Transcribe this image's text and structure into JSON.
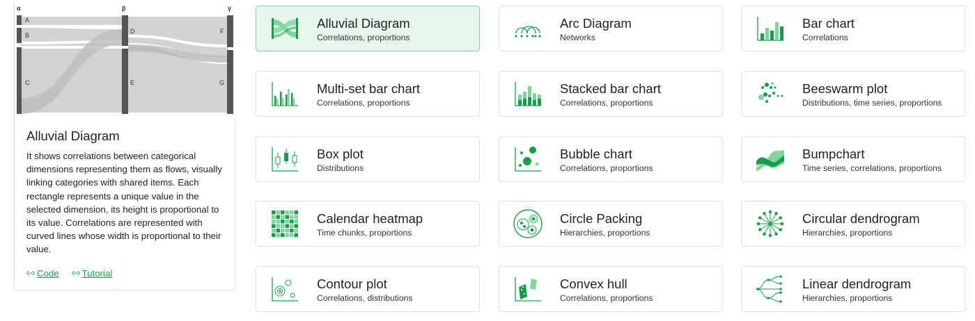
{
  "preview": {
    "dimensions": [
      "α",
      "β",
      "γ"
    ],
    "categories": [
      "A",
      "B",
      "C",
      "D",
      "E",
      "F",
      "G"
    ]
  },
  "detail": {
    "title": "Alluvial Diagram",
    "description": "It shows correlations between categorical dimensions representing them as flows, visually linking categories with shared items. Each rectangle represents a unique value in the selected dimension, its height is proportional to its value. Correlations are represented with curved lines whose width is proportional to their value.",
    "links": [
      {
        "label": "Code",
        "icon": "link-icon"
      },
      {
        "label": "Tutorial",
        "icon": "link-icon"
      }
    ]
  },
  "charts": [
    {
      "name": "Alluvial Diagram",
      "subtitle": "Correlations, proportions",
      "icon": "alluvial-icon",
      "selected": true
    },
    {
      "name": "Arc Diagram",
      "subtitle": "Networks",
      "icon": "arc-icon"
    },
    {
      "name": "Bar chart",
      "subtitle": "Correlations",
      "icon": "bar-icon"
    },
    {
      "name": "Multi-set bar chart",
      "subtitle": "Correlations, proportions",
      "icon": "multiset-bar-icon"
    },
    {
      "name": "Stacked bar chart",
      "subtitle": "Correlations, proportions",
      "icon": "stacked-bar-icon"
    },
    {
      "name": "Beeswarm plot",
      "subtitle": "Distributions, time series, proportions",
      "icon": "beeswarm-icon"
    },
    {
      "name": "Box plot",
      "subtitle": "Distributions",
      "icon": "boxplot-icon"
    },
    {
      "name": "Bubble chart",
      "subtitle": "Correlations, proportions",
      "icon": "bubble-icon"
    },
    {
      "name": "Bumpchart",
      "subtitle": "Time series, correlations, proportions",
      "icon": "bumpchart-icon"
    },
    {
      "name": "Calendar heatmap",
      "subtitle": "Time chunks, proportions",
      "icon": "calendar-heatmap-icon"
    },
    {
      "name": "Circle Packing",
      "subtitle": "Hierarchies, proportions",
      "icon": "circle-packing-icon"
    },
    {
      "name": "Circular dendrogram",
      "subtitle": "Hierarchies, proportions",
      "icon": "circular-dendrogram-icon"
    },
    {
      "name": "Contour plot",
      "subtitle": "Correlations, distributions",
      "icon": "contour-icon"
    },
    {
      "name": "Convex hull",
      "subtitle": "Correlations, proportions",
      "icon": "convex-hull-icon"
    },
    {
      "name": "Linear dendrogram",
      "subtitle": "Hierarchies, proportions",
      "icon": "linear-dendrogram-icon"
    }
  ],
  "colors": {
    "accent": "#1a9c4d",
    "accent_light": "#7fd49f",
    "selected_bg": "#e6f6ec",
    "flow": "#cfcfcf",
    "node": "#555555"
  }
}
